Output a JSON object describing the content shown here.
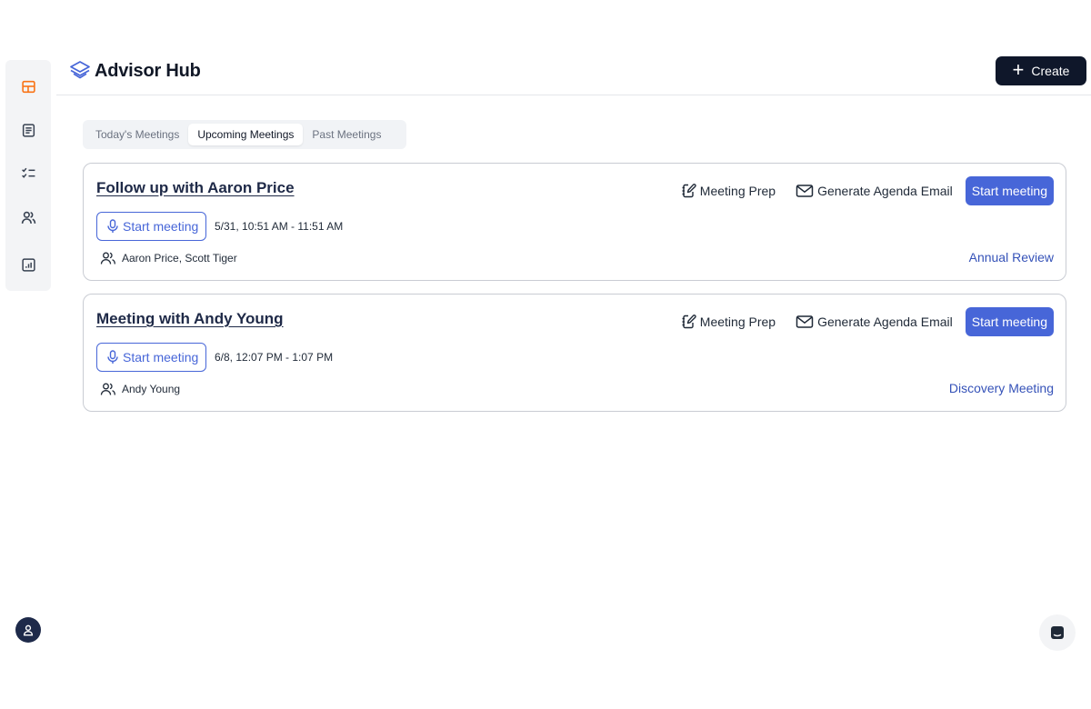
{
  "app": {
    "title": "Advisor Hub"
  },
  "header": {
    "create_label": "Create"
  },
  "sidebar": {
    "items": [
      {
        "icon": "dashboard-icon",
        "active": true
      },
      {
        "icon": "document-icon",
        "active": false
      },
      {
        "icon": "checklist-icon",
        "active": false
      },
      {
        "icon": "clients-icon",
        "active": false
      },
      {
        "icon": "report-icon",
        "active": false
      }
    ]
  },
  "tabs": [
    {
      "label": "Today's Meetings",
      "active": false
    },
    {
      "label": "Upcoming Meetings",
      "active": true
    },
    {
      "label": "Past Meetings",
      "active": false
    }
  ],
  "actions": {
    "meeting_prep": "Meeting Prep",
    "generate_email": "Generate Agenda Email",
    "start_meeting": "Start meeting"
  },
  "meetings": [
    {
      "title": "Follow up with Aaron Price",
      "start_label": "Start meeting",
      "time": "5/31, 10:51 AM - 11:51 AM",
      "attendees": "Aaron Price, Scott Tiger",
      "type": "Annual Review"
    },
    {
      "title": "Meeting with Andy Young",
      "start_label": "Start meeting",
      "time": "6/8, 12:07 PM - 1:07 PM",
      "attendees": "Andy Young",
      "type": "Discovery Meeting"
    }
  ],
  "colors": {
    "accent": "#4766d8",
    "active_nav": "#f97316",
    "primary_dark": "#0f172a",
    "link": "#3552b8"
  }
}
